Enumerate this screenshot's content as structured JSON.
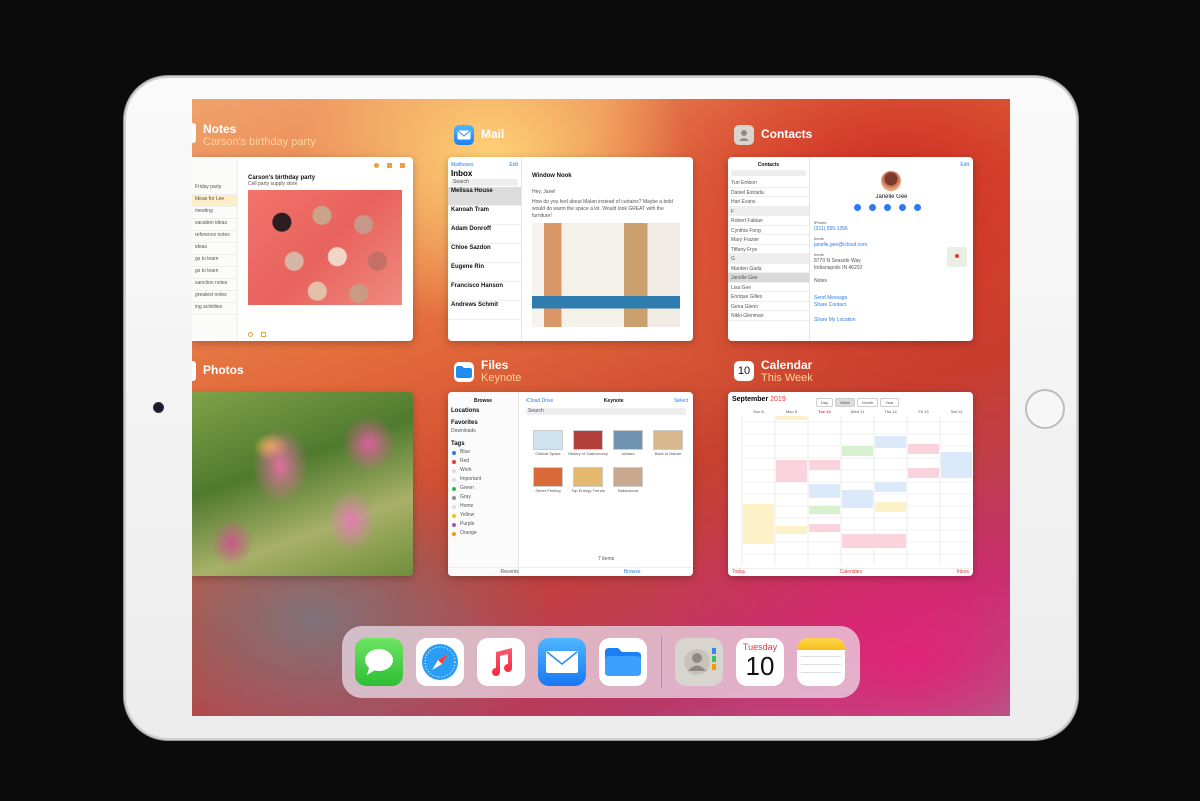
{
  "switcher": {
    "notes": {
      "name": "Notes",
      "subtitle": "Carson's birthday party",
      "note_title": "Carson's birthday party",
      "note_sub": "Cell party supply store",
      "list": [
        "Friday party",
        "Ideas for Lee",
        "meeting",
        "vacation ideas",
        "reference notes",
        "ideas",
        "gs to learn",
        "gs to learn",
        "sanction notes",
        "greatest notes",
        "ing activities"
      ]
    },
    "mail": {
      "name": "Mail",
      "back_label": "Mailboxes",
      "edit_label": "Edit",
      "inbox_label": "Inbox",
      "search_placeholder": "Search",
      "message_title": "Window Nook",
      "greeting": "Hey, Jane!",
      "body": "How do you feel about Malan instead of curtains? Maybe a bold would do warm the space a lot. Would look GREAT with the furniture!",
      "messages": [
        "Melissa House",
        "Kanoah Tram",
        "Adam Donroff",
        "Chloe Sazdon",
        "Eugene Rin",
        "Francisco Hanson",
        "Andrews Schmit"
      ]
    },
    "contacts": {
      "name": "Contacts",
      "header": "Contacts",
      "edit_label": "Edit",
      "contact_name": "Janelle Gee",
      "phone_label": "iPhone",
      "phone": "(311) 555-1356",
      "email_label": "home",
      "email": "janelle.gee@icloud.com",
      "address_label": "home",
      "address": "8770 N Seaside Way Indianapolis IN 46202",
      "notes_label": "Notes",
      "send_message": "Send Message",
      "share_contact": "Share Contact",
      "share_location": "Share My Location",
      "list": [
        "Yuri Embon",
        "Daniel Estrada",
        "Hari Evans",
        "F",
        "Robert Fabian",
        "Cynthia Fong",
        "Mary Frazier",
        "Tiffany Frye",
        "G",
        "Marden Gada",
        "Janelle Gee",
        "Lisa Gee",
        "Enrique Gilles",
        "Gena Glenn",
        "Nikki Glenman"
      ]
    },
    "photos": {
      "name": "Photos"
    },
    "files": {
      "name": "Files",
      "subtitle": "Keynote",
      "browse_label": "Browse",
      "icloud_label": "iCloud Drive",
      "folder_label": "Keynote",
      "select_label": "Select",
      "search_placeholder": "Search",
      "locations_label": "Locations",
      "favorites_label": "Favorites",
      "downloads_label": "Downloads",
      "tags_label": "Tags",
      "tags": [
        {
          "name": "Blue",
          "color": "#2b7cf0"
        },
        {
          "name": "Red",
          "color": "#e23b3b"
        },
        {
          "name": "Work",
          "color": "#dddddd"
        },
        {
          "name": "Important",
          "color": "#dddddd"
        },
        {
          "name": "Green",
          "color": "#38b24a"
        },
        {
          "name": "Gray",
          "color": "#8e8e93"
        },
        {
          "name": "Home",
          "color": "#dddddd"
        },
        {
          "name": "Yellow",
          "color": "#f5c21b"
        },
        {
          "name": "Purple",
          "color": "#9b59b6"
        },
        {
          "name": "Orange",
          "color": "#f39c12"
        }
      ],
      "files": [
        "Clinical Space",
        "History of Gastronomy",
        "Iceland",
        "Back to Nature",
        "Street Printing",
        "Top Energy Trends",
        "Salisbarrow"
      ],
      "items_count": "7 items",
      "tab_recents": "Recents",
      "tab_browse": "Browse"
    },
    "calendar": {
      "name": "Calendar",
      "subtitle": "This Week",
      "icon_day": "10",
      "month": "September",
      "year": "2019",
      "views": [
        "Day",
        "Week",
        "Month",
        "Year"
      ],
      "days": [
        "Sun 8",
        "Mon 9",
        "Tue 10",
        "Wed 11",
        "Thu 12",
        "Fri 13",
        "Sat 14"
      ],
      "today_label": "Today",
      "calendars_label": "Calendars",
      "inbox_label": "Inbox"
    }
  },
  "dock": {
    "apps": [
      {
        "name": "Messages",
        "icon": "messages-icon"
      },
      {
        "name": "Safari",
        "icon": "safari-icon"
      },
      {
        "name": "Music",
        "icon": "music-icon"
      },
      {
        "name": "Mail",
        "icon": "mail-icon"
      },
      {
        "name": "Files",
        "icon": "files-icon"
      },
      {
        "name": "Contacts",
        "icon": "contacts-icon"
      },
      {
        "name": "Calendar",
        "icon": "calendar-icon"
      },
      {
        "name": "Notes",
        "icon": "notes-icon"
      }
    ],
    "calendar_weekday": "Tuesday",
    "calendar_day": "10"
  },
  "colors": {
    "accent_orange": "#ffd39a",
    "ios_blue": "#2b7cf0",
    "today_red": "#e23b3b"
  }
}
